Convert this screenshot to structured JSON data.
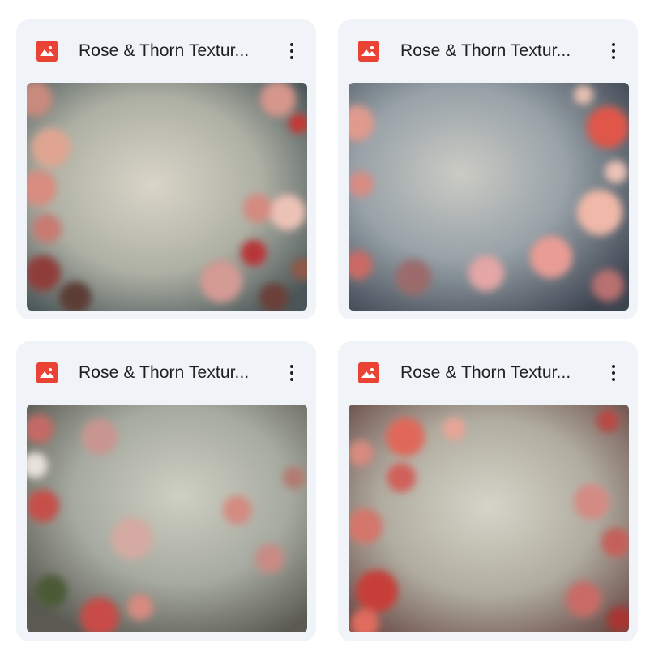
{
  "files": [
    {
      "title": "Rose & Thorn Textur...",
      "icon": "image-file-icon",
      "variant": "a"
    },
    {
      "title": "Rose & Thorn Textur...",
      "icon": "image-file-icon",
      "variant": "b"
    },
    {
      "title": "Rose & Thorn Textur...",
      "icon": "image-file-icon",
      "variant": "c"
    },
    {
      "title": "Rose & Thorn Textur...",
      "icon": "image-file-icon",
      "variant": "d"
    }
  ],
  "colors": {
    "card_bg": "#f0f4f9",
    "icon_red": "#ea4335",
    "text": "#1f1f1f"
  }
}
